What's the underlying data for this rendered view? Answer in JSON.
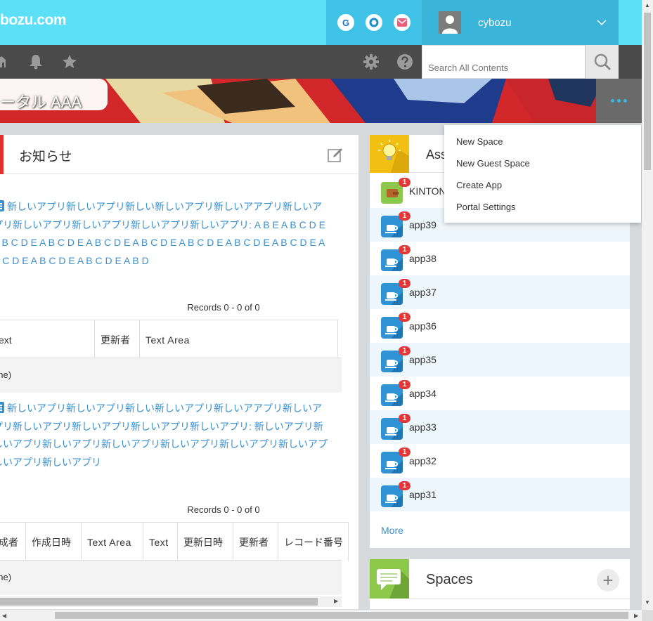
{
  "header": {
    "logo_text": "bozu.com",
    "services": [
      {
        "name": "garoon",
        "letter": "G",
        "color": "#1a73c9"
      },
      {
        "name": "office",
        "letter": "O",
        "color": "#1a8fc9"
      },
      {
        "name": "mailwise",
        "letter": "✉",
        "color": "#e8607a"
      }
    ],
    "user_name": "cybozu",
    "search_placeholder": "Search All Contents",
    "accent_color": "#5ce0f7"
  },
  "banner": {
    "title": "ータル AAA"
  },
  "notice": {
    "title": "お知らせ",
    "entry1_text": "新しいアプリ新しいアプリ新しい新しいアプリ新しいアアプリ新しいアプリ新しいアプリ新しいアプリ新しいアプリ新しいアプリ: A B E A B C D E A B C D E A B C D E A B C D E A B C D E A B C D E A B C D E A B C D E A B C D E A B C D E A B C D E A B D",
    "entry1_records": "Records 0 - 0  of 0",
    "entry1_columns": [
      "ext",
      "更新者",
      "Text Area"
    ],
    "entry1_none": "one)",
    "entry2_text": "新しいアプリ新しいアプリ新しい新しいアプリ新しいアアプリ新しいアプリ新しいアプリ新しいアプリ新しいアプリ新しいアプリ: 新しいアプリ新しいアプリ新しいアプリ新しいアプリ新しいアプリ新しいアプリ新しいアプしいアプリ新しいアプリ",
    "entry2_records": "Records 0 - 0  of 0",
    "entry2_columns": [
      "成者",
      "作成日時",
      "Text Area",
      "Text",
      "更新日時",
      "更新者",
      "レコード番号"
    ],
    "entry2_none": "one)"
  },
  "assigned": {
    "title": "Ass",
    "apps": [
      {
        "name": "KINTONE",
        "badge": "1",
        "icon": "wallet-icon",
        "color": "#8cc94a"
      },
      {
        "name": "app39",
        "badge": "1",
        "icon": "cup-icon",
        "color": "#2f93d6"
      },
      {
        "name": "app38",
        "badge": "1",
        "icon": "cup-icon",
        "color": "#2f93d6"
      },
      {
        "name": "app37",
        "badge": "1",
        "icon": "cup-icon",
        "color": "#2f93d6"
      },
      {
        "name": "app36",
        "badge": "1",
        "icon": "cup-icon",
        "color": "#2f93d6"
      },
      {
        "name": "app35",
        "badge": "1",
        "icon": "cup-icon",
        "color": "#2f93d6"
      },
      {
        "name": "app34",
        "badge": "1",
        "icon": "cup-icon",
        "color": "#2f93d6"
      },
      {
        "name": "app33",
        "badge": "1",
        "icon": "cup-icon",
        "color": "#2f93d6"
      },
      {
        "name": "app32",
        "badge": "1",
        "icon": "cup-icon",
        "color": "#2f93d6"
      },
      {
        "name": "app31",
        "badge": "1",
        "icon": "cup-icon",
        "color": "#2f93d6"
      }
    ],
    "more_label": "More"
  },
  "spaces": {
    "title": "Spaces",
    "add_label": "+"
  },
  "dropdown": {
    "items": [
      "New Space",
      "New Guest Space",
      "Create App",
      "Portal Settings"
    ]
  }
}
